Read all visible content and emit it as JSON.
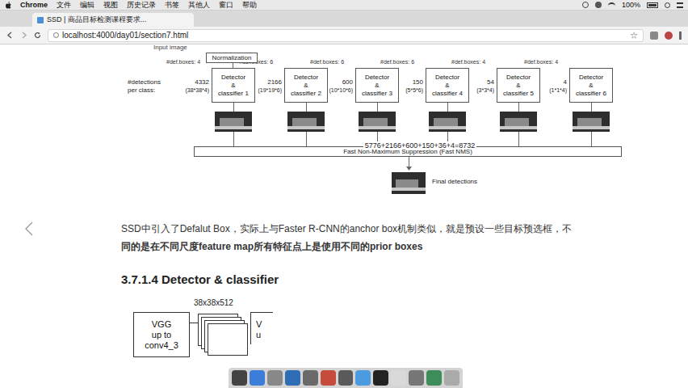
{
  "menubar": {
    "app": "Chrome",
    "items": [
      "文件",
      "编辑",
      "视图",
      "历史记录",
      "书签",
      "其他人",
      "窗口",
      "帮助"
    ],
    "battery": "100%"
  },
  "browser": {
    "tab": {
      "title": "SSD | 商品目标检测课程要求...",
      "selected": true
    },
    "address": "localhost:4000/day01/section7.html"
  },
  "diagram": {
    "input_label": "Input image",
    "normalization": "Normalization",
    "detections_label": [
      "#detections",
      "per class:"
    ],
    "detectors": [
      {
        "def": "#def.boxes: 4",
        "count": "4332",
        "shape": "(38*38*4)",
        "lines": [
          "Detector",
          "&",
          "classifier 1"
        ]
      },
      {
        "def": "#def.boxes: 6",
        "count": "2166",
        "shape": "(19*19*6)",
        "lines": [
          "Detector",
          "&",
          "classifier 2"
        ]
      },
      {
        "def": "#def.boxes: 6",
        "count": "600",
        "shape": "(10*10*6)",
        "lines": [
          "Detector",
          "&",
          "classifier 3"
        ]
      },
      {
        "def": "#def.boxes: 6",
        "count": "150",
        "shape": "(5*5*6)",
        "lines": [
          "Detector",
          "&",
          "classifier 4"
        ]
      },
      {
        "def": "#def.boxes: 4",
        "count": "54",
        "shape": "(3*3*4)",
        "lines": [
          "Detector",
          "&",
          "classifier 5"
        ]
      },
      {
        "def": "#def.boxes: 4",
        "count": "4",
        "shape": "(1*1*4)",
        "lines": [
          "Detector",
          "&",
          "classifier 6"
        ]
      }
    ],
    "sum": "5776+2166+600+150+36+4=8732",
    "nms": "Fast Non-Maximum Suppression (Fast NMS)",
    "final": "Final detections"
  },
  "paragraph": [
    {
      "text": "SSD中引入了Defalut Box，实际上与Faster R-CNN的anchor box机制类似，就是预设一些目标预选框，不",
      "bold": false
    },
    {
      "text": "同的是在不同尺度feature map所有特征点上是使用不同的prior boxes",
      "bold": true
    }
  ],
  "heading": "3.7.1.4 Detector & classifier",
  "vgg_diagram": {
    "size": "38x38x512",
    "block_lines": [
      "VGG",
      "up to",
      "conv4_3"
    ],
    "next_block_lines": [
      "V",
      "u"
    ]
  }
}
